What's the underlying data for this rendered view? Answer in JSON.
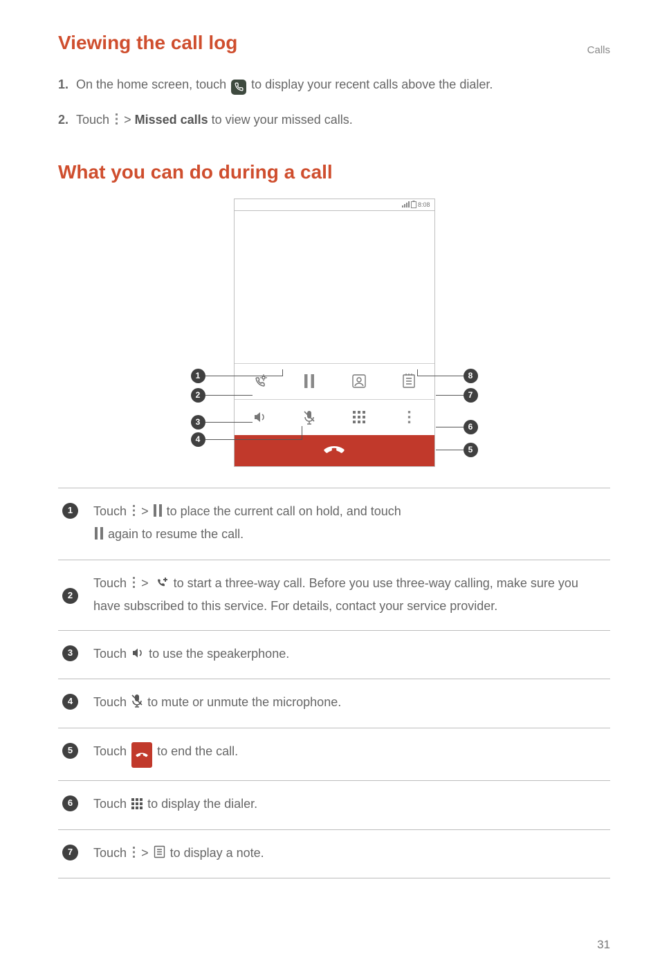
{
  "header": {
    "section": "Calls"
  },
  "headings": {
    "viewing": "Viewing the call log",
    "during": "What you can do during a call"
  },
  "steps": {
    "s1_num": "1.",
    "s1_a": "On the home screen, touch ",
    "s1_b": " to display your recent calls above the dialer.",
    "s2_num": "2.",
    "s2_a": "Touch ",
    "s2_b": " > ",
    "s2_c": "Missed calls",
    "s2_d": " to view your missed calls."
  },
  "phone": {
    "time": "8:08"
  },
  "badges": [
    "1",
    "2",
    "3",
    "4",
    "5",
    "6",
    "7",
    "8"
  ],
  "items": {
    "i1_a": "Touch ",
    "i1_b": " > ",
    "i1_c": " to place the current call on hold, and touch ",
    "i1_d": " again to resume the call.",
    "i2_a": "Touch ",
    "i2_b": " > ",
    "i2_c": " to start a three-way call. Before you use three-way calling, make sure you have subscribed to this service. For details, contact your service provider.",
    "i3_a": "Touch ",
    "i3_b": " to use the speakerphone.",
    "i4_a": "Touch ",
    "i4_b": " to mute or unmute the microphone.",
    "i5_a": "Touch ",
    "i5_b": " to end the call.",
    "i6_a": "Touch ",
    "i6_b": " to display the dialer.",
    "i7_a": "Touch ",
    "i7_b": " > ",
    "i7_c": " to display a note."
  },
  "page": "31"
}
